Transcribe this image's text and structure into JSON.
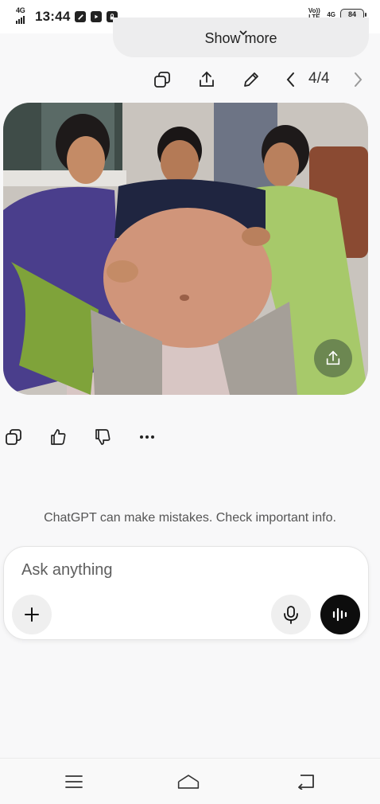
{
  "status_bar": {
    "network": "4G",
    "time": "13:44",
    "volte": "Vo)) LTE",
    "network_right": "4G",
    "battery": "84"
  },
  "show_more": {
    "label": "Show more"
  },
  "toolbar": {
    "counter": "4/4"
  },
  "image": {
    "alt_icon": "share-icon"
  },
  "actions": {
    "icons": [
      "copy-icon",
      "thumbs-up-icon",
      "thumbs-down-icon",
      "more-icon"
    ]
  },
  "disclaimer": "ChatGPT can make mistakes. Check important info.",
  "composer": {
    "placeholder": "Ask anything"
  },
  "nav": {
    "icons": [
      "menu-icon",
      "home-icon",
      "back-icon"
    ]
  },
  "colors": {
    "voice_button": "#0d0d0d",
    "background": "#f8f8f9"
  }
}
